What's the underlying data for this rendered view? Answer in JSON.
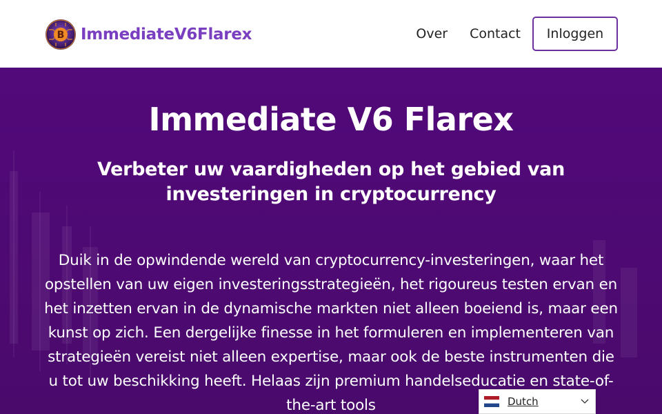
{
  "header": {
    "brand": "ImmediateV6Flarex",
    "nav": {
      "about": "Over",
      "contact": "Contact",
      "login": "Inloggen"
    }
  },
  "hero": {
    "title": "Immediate V6 Flarex",
    "subtitle": "Verbeter uw vaardigheden op het gebied van investeringen in cryptocurrency",
    "body": "Duik in de opwindende wereld van cryptocurrency-investeringen, waar het opstellen van uw eigen investeringsstrategieën, het rigoureus testen ervan en het inzetten ervan in de dynamische markten niet alleen boeiend is, maar een kunst op zich. Een dergelijke finesse in het formuleren en implementeren van strategieën vereist niet alleen expertise, maar ook de beste instrumenten die u tot uw beschikking heeft. Helaas zijn premium handelseducatie en state-of-the-art tools"
  },
  "language": {
    "selected": "Dutch",
    "flag_icon": "netherlands-flag-icon"
  },
  "colors": {
    "brand": "#7a3fc0",
    "hero_bg": "#4e0a72",
    "button_border": "#6b2f9e"
  }
}
